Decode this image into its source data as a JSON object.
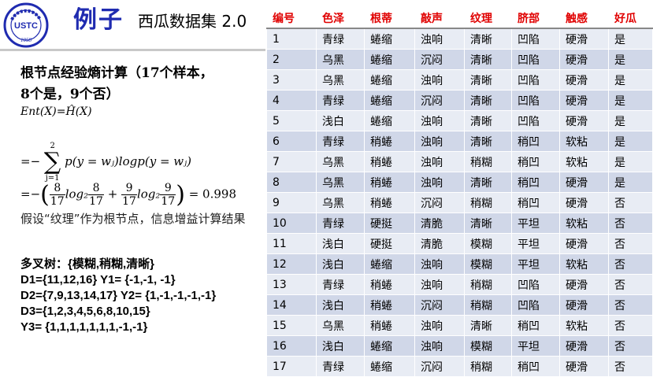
{
  "header": {
    "logo_text": "USTC",
    "logo_year": "1958",
    "title_main": "例子",
    "title_sub": "西瓜数据集 2.0"
  },
  "left": {
    "heading_line1": "根节点经验熵计算（17个样本，",
    "heading_line2": "8个是，9个否）",
    "formula1": "Ent(X)=Ĥ(X)",
    "formula2": {
      "prefix": "=−",
      "sum_top": "2",
      "sum_bottom": "j=1",
      "body": "p(y = wⱼ)logp(y = wⱼ)"
    },
    "formula3": {
      "prefix": "=−",
      "frac1_num": "8",
      "frac1_den": "17",
      "log_label": "log₂",
      "frac2_num": "8",
      "frac2_den": "17",
      "plus": "+",
      "frac3_num": "9",
      "frac3_den": "17",
      "frac4_num": "9",
      "frac4_den": "17",
      "result": "= 0.998"
    },
    "assumption": "假设“纹理”作为根节点，信息增益计算结果",
    "multi_tree": "多叉树：{模糊,稍糊,清晰}",
    "d_rows": [
      "D1={11,12,16}         Y1= {-1,-1, -1}",
      "D2={7,9,13,14,17}   Y2= {1,-1,-1,-1,-1}",
      "D3={1,2,3,4,5,6,8,10,15}",
      "Y3= {1,1,1,1,1,1,1,-1,-1}"
    ]
  },
  "table": {
    "headers": [
      "编号",
      "色泽",
      "根蒂",
      "敲声",
      "纹理",
      "脐部",
      "触感",
      "好瓜"
    ],
    "rows": [
      [
        "1",
        "青绿",
        "蜷缩",
        "浊响",
        "清晰",
        "凹陷",
        "硬滑",
        "是"
      ],
      [
        "2",
        "乌黑",
        "蜷缩",
        "沉闷",
        "清晰",
        "凹陷",
        "硬滑",
        "是"
      ],
      [
        "3",
        "乌黑",
        "蜷缩",
        "浊响",
        "清晰",
        "凹陷",
        "硬滑",
        "是"
      ],
      [
        "4",
        "青绿",
        "蜷缩",
        "沉闷",
        "清晰",
        "凹陷",
        "硬滑",
        "是"
      ],
      [
        "5",
        "浅白",
        "蜷缩",
        "浊响",
        "清晰",
        "凹陷",
        "硬滑",
        "是"
      ],
      [
        "6",
        "青绿",
        "稍蜷",
        "浊响",
        "清晰",
        "稍凹",
        "软粘",
        "是"
      ],
      [
        "7",
        "乌黑",
        "稍蜷",
        "浊响",
        "稍糊",
        "稍凹",
        "软粘",
        "是"
      ],
      [
        "8",
        "乌黑",
        "稍蜷",
        "浊响",
        "清晰",
        "稍凹",
        "硬滑",
        "是"
      ],
      [
        "9",
        "乌黑",
        "稍蜷",
        "沉闷",
        "稍糊",
        "稍凹",
        "硬滑",
        "否"
      ],
      [
        "10",
        "青绿",
        "硬挺",
        "清脆",
        "清晰",
        "平坦",
        "软粘",
        "否"
      ],
      [
        "11",
        "浅白",
        "硬挺",
        "清脆",
        "模糊",
        "平坦",
        "硬滑",
        "否"
      ],
      [
        "12",
        "浅白",
        "蜷缩",
        "浊响",
        "模糊",
        "平坦",
        "软粘",
        "否"
      ],
      [
        "13",
        "青绿",
        "稍蜷",
        "浊响",
        "稍糊",
        "凹陷",
        "硬滑",
        "否"
      ],
      [
        "14",
        "浅白",
        "稍蜷",
        "沉闷",
        "稍糊",
        "凹陷",
        "硬滑",
        "否"
      ],
      [
        "15",
        "乌黑",
        "稍蜷",
        "浊响",
        "清晰",
        "稍凹",
        "软粘",
        "否"
      ],
      [
        "16",
        "浅白",
        "蜷缩",
        "浊响",
        "模糊",
        "平坦",
        "硬滑",
        "否"
      ],
      [
        "17",
        "青绿",
        "蜷缩",
        "沉闷",
        "稍糊",
        "稍凹",
        "硬滑",
        "否"
      ]
    ]
  },
  "colors": {
    "title_blue": "#1f2bb0",
    "header_red": "#e00000",
    "row_light": "#e8ecf4",
    "row_dark": "#d0d7e8"
  }
}
